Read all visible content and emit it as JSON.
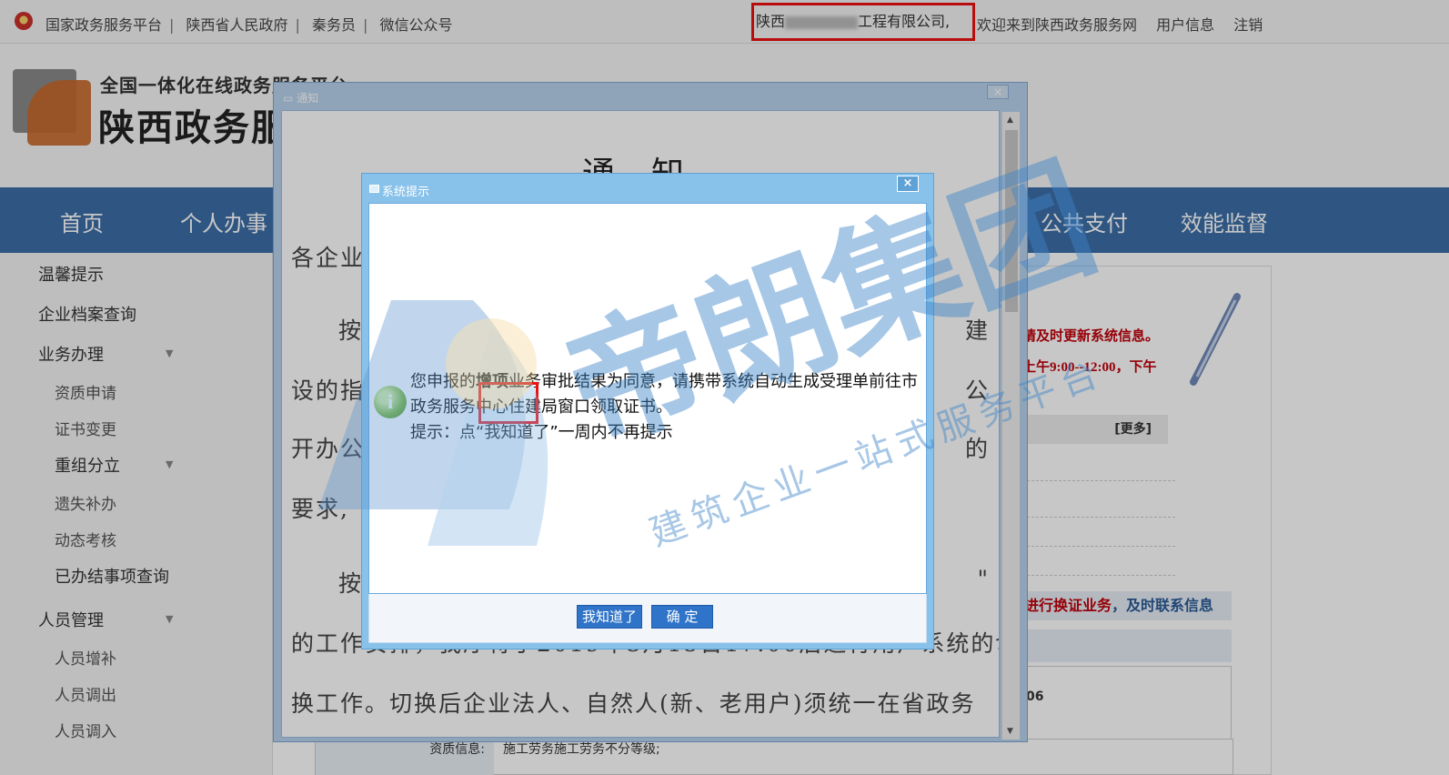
{
  "topbar": {
    "links": [
      "国家政务服务平台",
      "陕西省人民政府",
      "秦务员",
      "微信公众号"
    ],
    "company_prefix": "陕西",
    "company_suffix": "工程有限公司,",
    "welcome": "欢迎来到陕西政务服务网",
    "user_info": "用户信息",
    "logout": "注销"
  },
  "header": {
    "line1": "全国一体化在线政务服务平台",
    "line2": "陕西政务服"
  },
  "nav": {
    "items": [
      "首页",
      "个人办事",
      "公共支付",
      "效能监督"
    ]
  },
  "sidebar": {
    "tips": "温馨提示",
    "archive": "企业档案查询",
    "business": "业务办理",
    "business_sub": [
      "资质申请",
      "证书变更"
    ],
    "reorg": "重组分立",
    "reorg_sub": [
      "遗失补办",
      "动态考核",
      "已办结事项查询"
    ],
    "personnel": "人员管理",
    "personnel_sub": [
      "人员增补",
      "人员调出",
      "人员调入"
    ]
  },
  "right_panel": {
    "red1": "请及时更新系统信息。",
    "red2": "上午9:00--12:00，下午",
    "more": "[更多]",
    "notice_red": "进行换证业务",
    "notice_blue": "，及时联系信息",
    "code": "06"
  },
  "info_row": {
    "label": "资质信息:",
    "value": "施工劳务施工劳务不分等级;"
  },
  "notice_window": {
    "title": "通知",
    "close": "×",
    "heading": "通知",
    "p1": "各企业",
    "p2a": "按",
    "p2b": "建",
    "p3a": "设的指",
    "p3b": "公",
    "p4a": "开办公",
    "p4b": "的",
    "p5": "要求,",
    "p6a": "按",
    "p6b": "\"",
    "p7": "的工作安排，我厅将于2019年3月15日17:00后进行用户系统的切",
    "p8": "换工作。切换后企业法人、自然人(新、老用户)须统一在省政务"
  },
  "dialog": {
    "title": "系统提示",
    "close": "×",
    "msg_prefix": "您申报的",
    "msg_highlight": "增项",
    "msg_rest": "业务审批结果为同意，请携带系统自动生成受理单前往市政务服务中心住建局窗口领取证书。",
    "hint": "提示：点“我知道了”一周内不再提示",
    "btn_know": "我知道了",
    "btn_ok": "确 定"
  },
  "watermark": {
    "main": "帝朗集团",
    "sub": "建筑企业一站式服务平台"
  },
  "colors": {
    "nav_blue": "#3d6fa8",
    "highlight_red": "#e11",
    "button_blue": "#2f74c8"
  }
}
